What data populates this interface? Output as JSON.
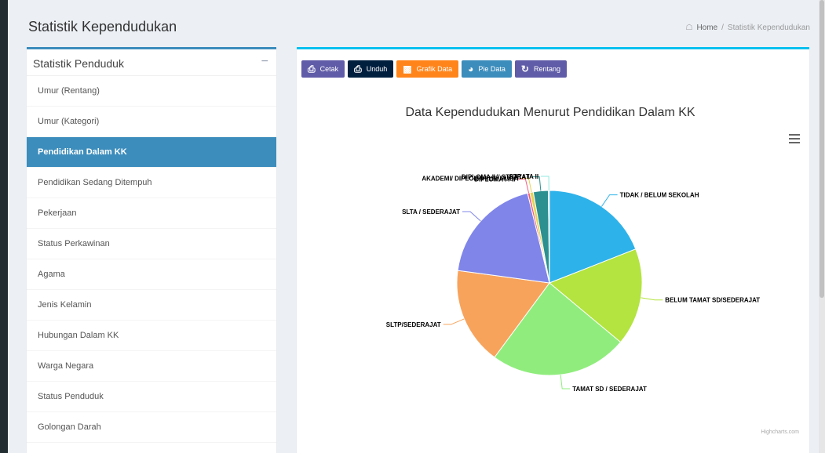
{
  "page": {
    "title": "Statistik Kependudukan",
    "breadcrumb": {
      "home": "Home",
      "current": "Statistik Kependudukan"
    }
  },
  "sidebar": {
    "title": "Statistik Penduduk",
    "collapse_label": "−",
    "items": [
      {
        "label": "Umur (Rentang)",
        "active": false
      },
      {
        "label": "Umur (Kategori)",
        "active": false
      },
      {
        "label": "Pendidikan Dalam KK",
        "active": true
      },
      {
        "label": "Pendidikan Sedang Ditempuh",
        "active": false
      },
      {
        "label": "Pekerjaan",
        "active": false
      },
      {
        "label": "Status Perkawinan",
        "active": false
      },
      {
        "label": "Agama",
        "active": false
      },
      {
        "label": "Jenis Kelamin",
        "active": false
      },
      {
        "label": "Hubungan Dalam KK",
        "active": false
      },
      {
        "label": "Warga Negara",
        "active": false
      },
      {
        "label": "Status Penduduk",
        "active": false
      },
      {
        "label": "Golongan Darah",
        "active": false
      }
    ]
  },
  "toolbar": {
    "cetak": "Cetak",
    "unduh": "Unduh",
    "grafik": "Grafik Data",
    "pie": "Pie Data",
    "rentang": "Rentang"
  },
  "chart_data": {
    "type": "pie",
    "title": "Data Kependudukan Menurut Pendidikan Dalam KK",
    "credit": "Highcharts.com",
    "slices": [
      {
        "label": "TIDAK / BELUM SEKOLAH",
        "value": 19,
        "color": "#2eb2ea"
      },
      {
        "label": "BELUM TAMAT SD/SEDERAJAT",
        "value": 17,
        "color": "#b3e43f"
      },
      {
        "label": "TAMAT SD / SEDERAJAT",
        "value": 24,
        "color": "#90ed7d"
      },
      {
        "label": "SLTP/SEDERAJAT",
        "value": 17,
        "color": "#f7a35c"
      },
      {
        "label": "SLTA / SEDERAJAT",
        "value": 19,
        "color": "#8085e9"
      },
      {
        "label": "DIPLOMA I / II",
        "value": 0.4,
        "color": "#f15c80"
      },
      {
        "label": "AKADEMI/ DIPLOMA III/S. MUDA",
        "value": 0.6,
        "color": "#e4d354"
      },
      {
        "label": "DIPLOMA IV/ STRATA I",
        "value": 2.6,
        "color": "#2b908f"
      },
      {
        "label": "STRATA II",
        "value": 0.2,
        "color": "#91e8e1"
      }
    ]
  }
}
